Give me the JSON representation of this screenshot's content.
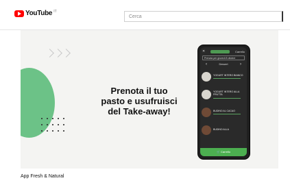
{
  "header": {
    "logo_text": "YouTube",
    "country_code": "IT",
    "search_placeholder": "Cerca"
  },
  "video": {
    "headline_lines": [
      "Prenota il tuo",
      "pasto e usufruisci",
      "del Take-away!"
    ],
    "phone": {
      "close": "✕",
      "cart_top": "Carrello",
      "booking": "Prenota per giovedì 8 ottobre",
      "category": "Dessert",
      "prev": "‹",
      "next": "›",
      "items": [
        {
          "name": "YOGURT INTERO BIANCO"
        },
        {
          "name": "YOGURT INTERO ALLA FRUTTA"
        },
        {
          "name": "BUDINO AL CACAO"
        },
        {
          "name": "BUDINO ALLA"
        }
      ],
      "cart_button": "Carrello"
    }
  },
  "details": {
    "title": "App Fresh & Natural"
  },
  "colors": {
    "brand_red": "#ff0000",
    "accent_green": "#6cc287",
    "phone_green": "#4caf50"
  }
}
